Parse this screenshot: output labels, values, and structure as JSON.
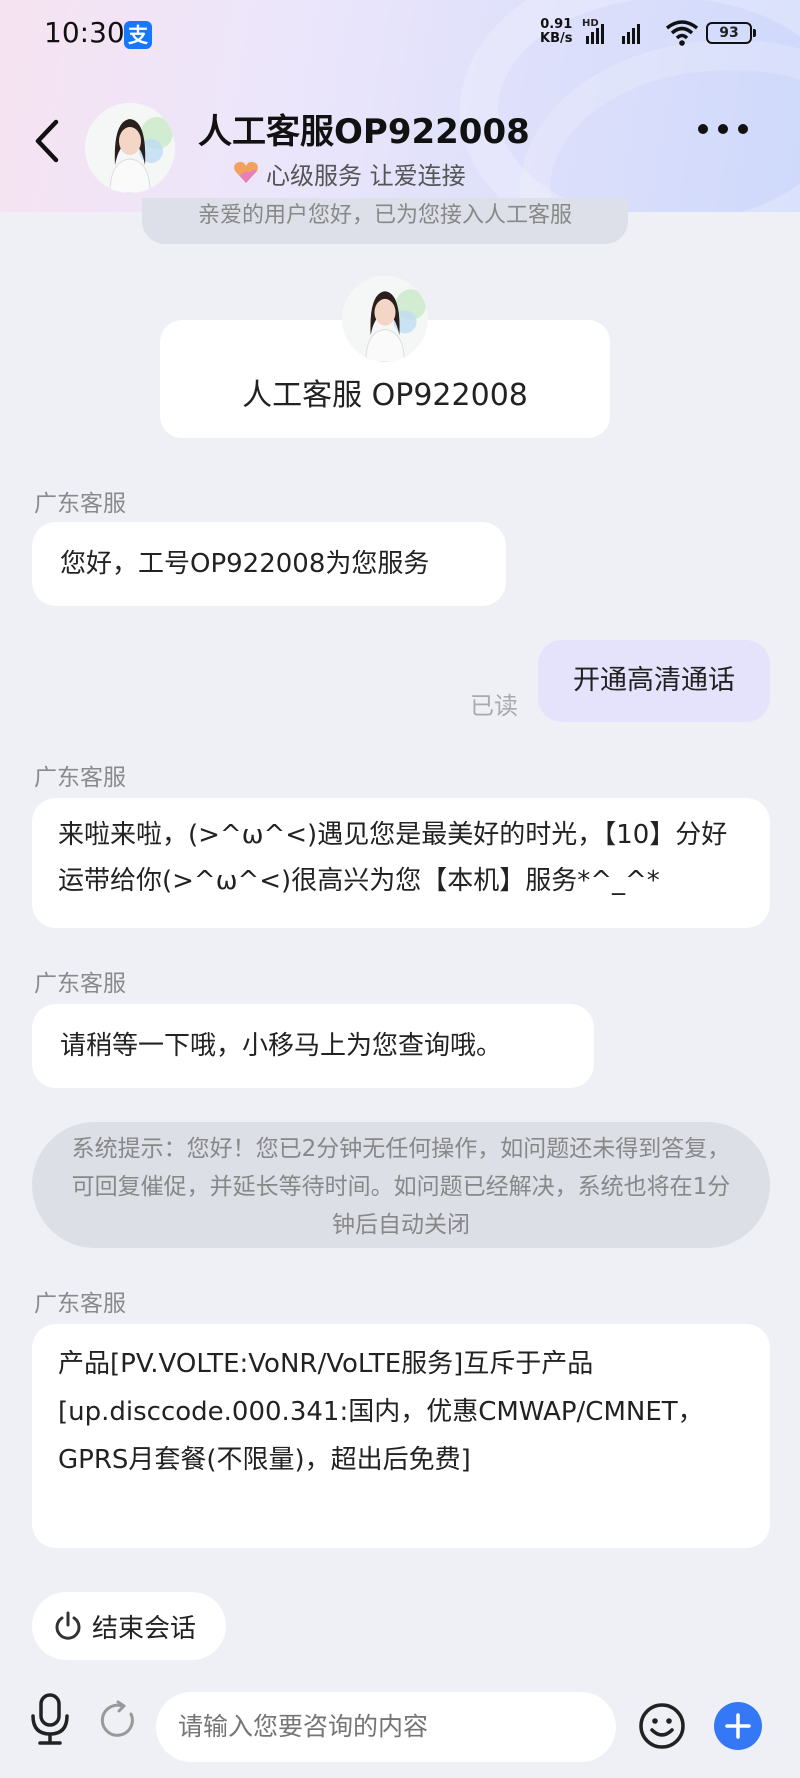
{
  "status_bar": {
    "time": "10:30",
    "app_badge": "支",
    "speed_value": "0.91",
    "speed_unit": "KB/s",
    "hd_label": "HD",
    "battery": "93"
  },
  "header": {
    "agent_name": "人工客服OP922008",
    "slogan": "心级服务 让爱连接"
  },
  "chat": {
    "system_top": "亲爱的用户您好，已为您接入人工客服",
    "agent_card_name": "人工客服 OP922008",
    "messages": [
      {
        "sender": "广东客服",
        "text": "您好，工号OP922008为您服务"
      },
      {
        "user_text": "开通高清通话",
        "status": "已读"
      },
      {
        "sender": "广东客服",
        "text": "来啦来啦，(>^ω^<)遇见您是最美好的时光，【10】分好运带给你(>^ω^<)很高兴为您【本机】服务*^_^*"
      },
      {
        "sender": "广东客服",
        "text": "请稍等一下哦，小移马上为您查询哦。"
      },
      {
        "system_text": "系统提示：您好！您已2分钟无任何操作，如问题还未得到答复，可回复催促，并延长等待时间。如问题已经解决，系统也将在1分钟后自动关闭"
      },
      {
        "sender": "广东客服",
        "text": "产品[PV.VOLTE:VoNR/VoLTE服务]互斥于产品[up.disccode.000.341:国内，优惠CMWAP/CMNET，GPRS月套餐(不限量)，超出后免费]"
      }
    ],
    "end_session_label": "结束会话"
  },
  "input_bar": {
    "placeholder": "请输入您要咨询的内容"
  },
  "icons": [
    "back-arrow-icon",
    "more-icon",
    "microphone-icon",
    "refresh-icon",
    "emoji-icon",
    "plus-icon",
    "power-icon",
    "heart-icon",
    "wifi-icon",
    "signal-icon",
    "battery-icon"
  ],
  "colors": {
    "user_bubble": "#e5e2fb",
    "accent": "#3578f6",
    "background": "#eef0f6"
  }
}
